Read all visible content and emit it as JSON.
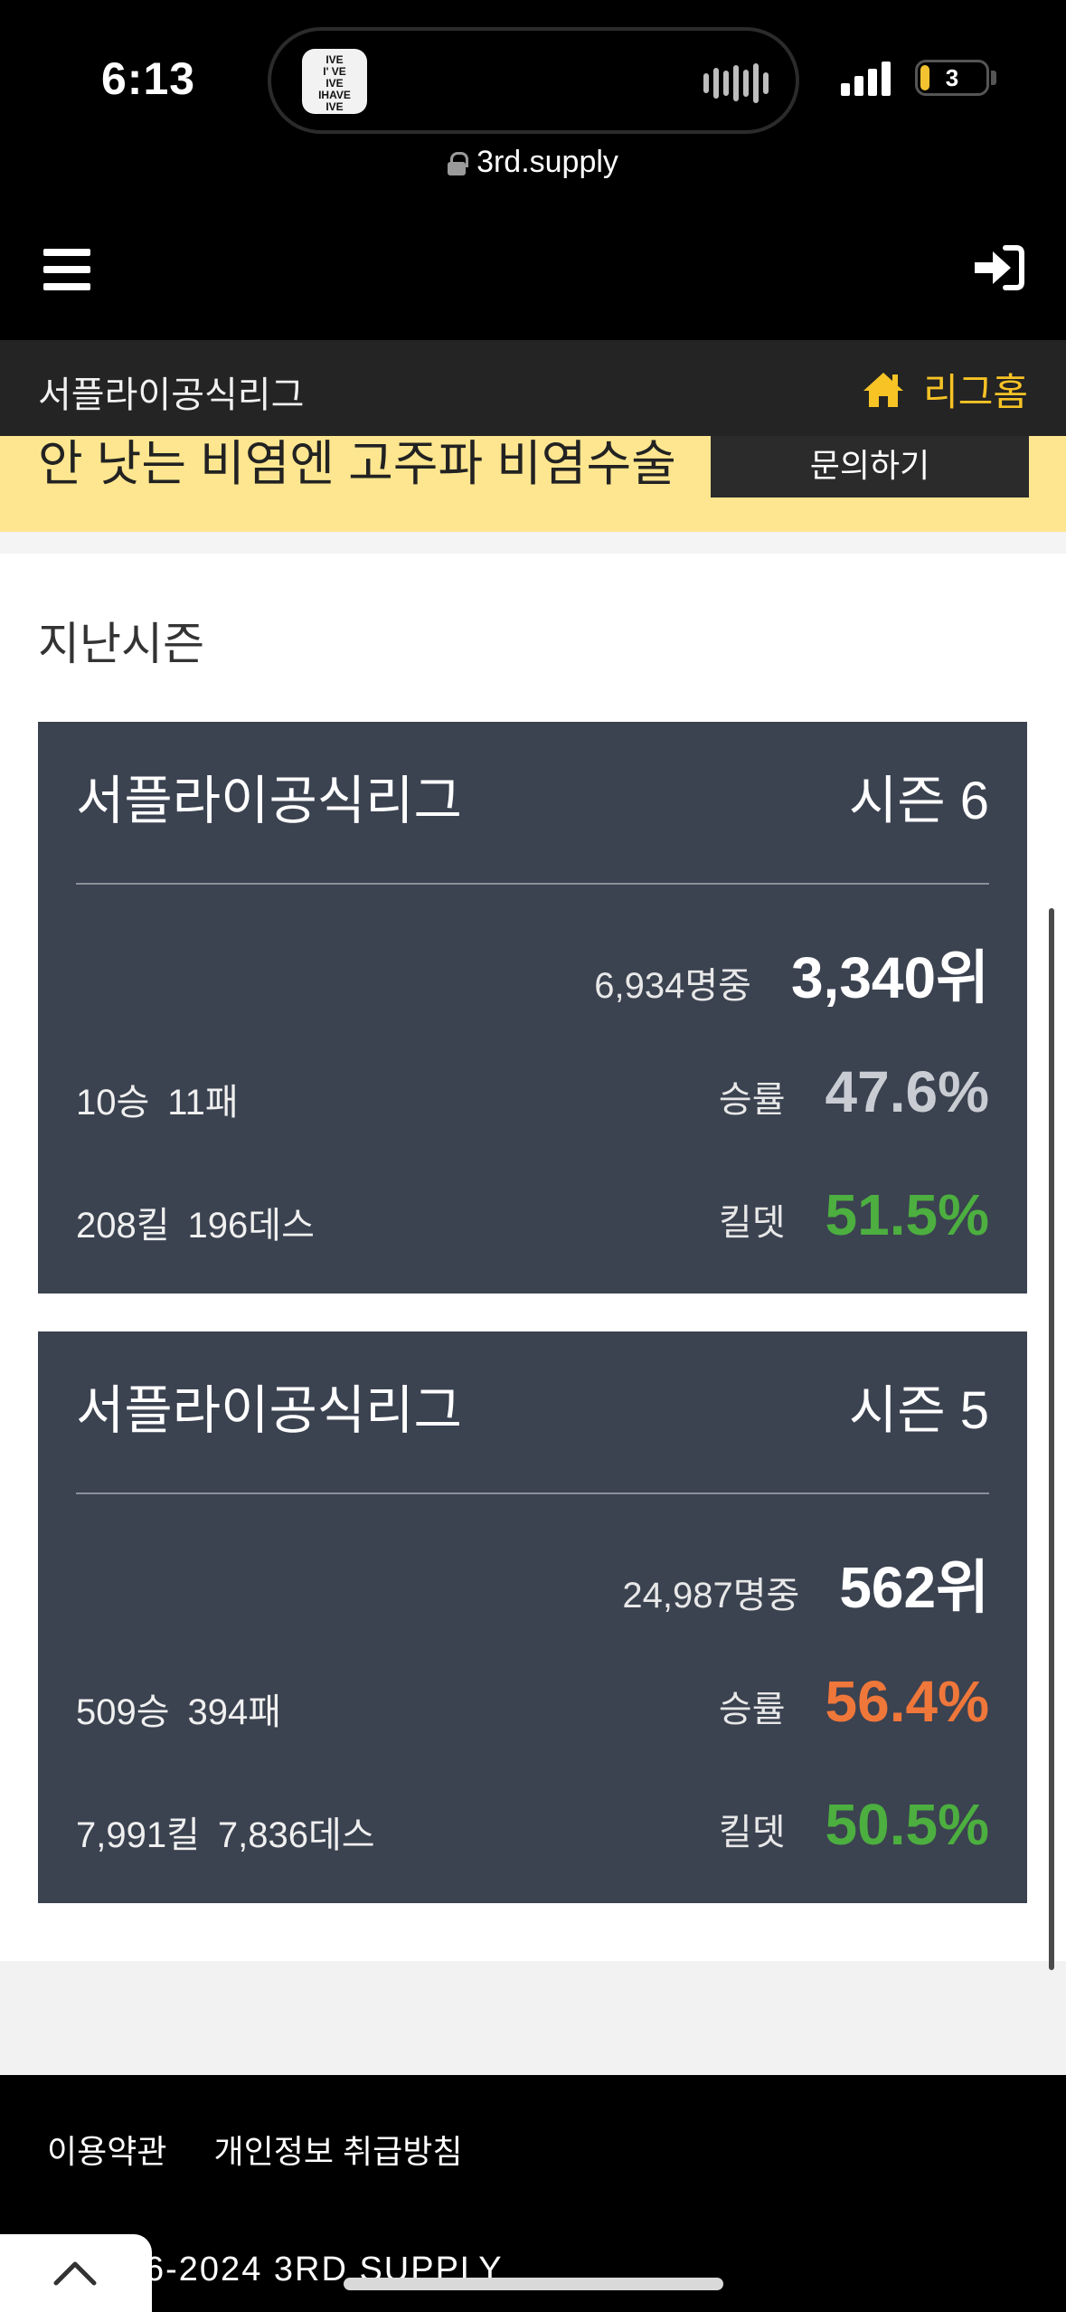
{
  "status_bar": {
    "time": "6:13",
    "island_app_text": [
      "IVE",
      "I' VE",
      "IVE",
      "IHAVE",
      "IVE"
    ],
    "battery_level": "3",
    "url": "3rd.supply"
  },
  "header": {
    "menu_icon": "hamburger-icon",
    "login_icon": "sign-in-icon"
  },
  "league_bar": {
    "name": "서플라이공식리그",
    "home_label": "리그홈",
    "home_color": "#f7c325"
  },
  "banner": {
    "text": "안 낫는 비염엔 고주파 비염수술",
    "button_label": "문의하기"
  },
  "section_title": "지난시즌",
  "seasons": [
    {
      "league": "서플라이공식리그",
      "season": "시즌 6",
      "total": "6,934명중",
      "rank": "3,340위",
      "wins": "10승",
      "losses": "11패",
      "winrate_label": "승률",
      "winrate": "47.6%",
      "winrate_color": "#c9cdd3",
      "kills": "208킬",
      "deaths": "196데스",
      "kd_label": "킬뎃",
      "kd": "51.5%",
      "kd_color": "#4caf3f"
    },
    {
      "league": "서플라이공식리그",
      "season": "시즌 5",
      "total": "24,987명중",
      "rank": "562위",
      "wins": "509승",
      "losses": "394패",
      "winrate_label": "승률",
      "winrate": "56.4%",
      "winrate_color": "#f0773a",
      "kills": "7,991킬",
      "deaths": "7,836데스",
      "kd_label": "킬뎃",
      "kd": "50.5%",
      "kd_color": "#4caf3f"
    }
  ],
  "footer": {
    "links": [
      "이용약관",
      "개인정보 취급방침"
    ],
    "copyright": "6-2024 3RD SUPPLY",
    "scroll_top_icon": "chevron-up-icon"
  }
}
